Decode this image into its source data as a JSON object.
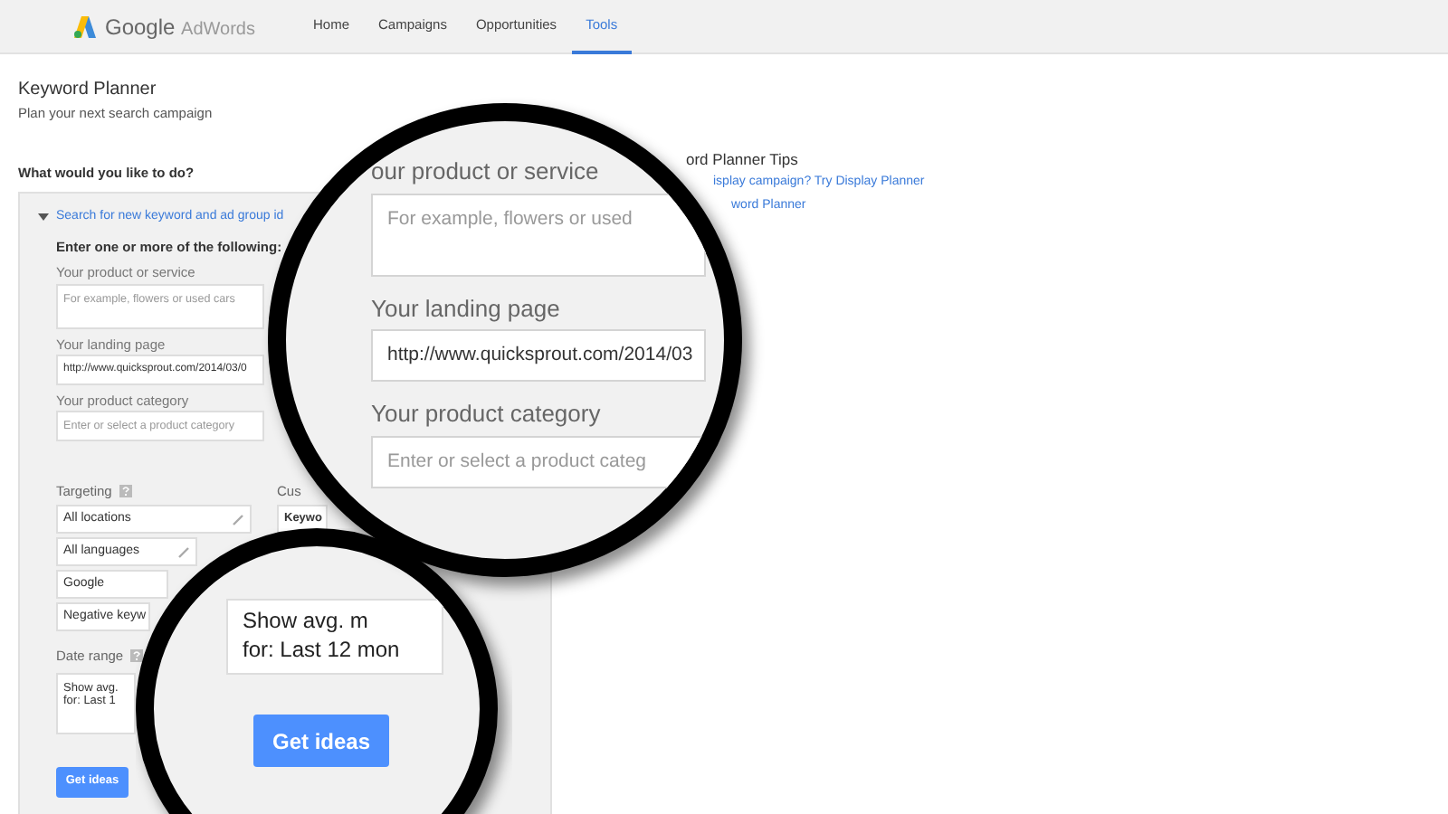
{
  "header": {
    "logo": "Google",
    "product": "AdWords",
    "nav": [
      {
        "label": "Home",
        "selected": false
      },
      {
        "label": "Campaigns",
        "selected": false
      },
      {
        "label": "Opportunities",
        "selected": false
      },
      {
        "label": "Tools",
        "selected": true
      }
    ]
  },
  "page": {
    "title": "Keyword Planner",
    "subtitle": "Plan your next search campaign"
  },
  "question": "What would you like to do?",
  "panel": {
    "option": {
      "label": "Search for new keyword and ad group id",
      "expanded": true
    },
    "instructions": "Enter one or more of the following:",
    "fields": [
      {
        "kind": "textarea",
        "label": "Your product or service",
        "placeholder": "For example, flowers or used cars"
      },
      {
        "kind": "input",
        "label": "Your landing page",
        "value": "http://www.quicksprout.com/2014/03/0"
      },
      {
        "kind": "input",
        "label": "Your product category",
        "placeholder": "Enter or select a product category"
      }
    ],
    "targeting": {
      "label": "Targeting",
      "items": [
        {
          "label": "All locations",
          "pencil": true
        },
        {
          "label": "All languages",
          "pencil": true
        },
        {
          "label": "Google",
          "pencil": false
        },
        {
          "label": "Negative keyw",
          "pencil": false
        }
      ]
    },
    "date_range": {
      "label": "Date range",
      "lines": [
        "Show avg.",
        "for: Last 1"
      ]
    },
    "button": "Get ideas",
    "customize": {
      "label": "Cus",
      "items": [
        "Keywo"
      ]
    }
  },
  "tips": {
    "title": "ord Planner Tips",
    "links": [
      "isplay campaign? Try Display Planner",
      "word Planner"
    ]
  },
  "magnifiers": [
    {
      "kind": "form",
      "fields": [
        {
          "kind": "textarea",
          "label": "our product or service",
          "placeholder": "For example, flowers or used"
        },
        {
          "kind": "input",
          "label": "Your landing page",
          "value": "http://www.quicksprout.com/2014/03"
        },
        {
          "kind": "input",
          "label": "Your product category",
          "placeholder": "Enter or select a product categ"
        }
      ]
    },
    {
      "kind": "button",
      "lines": [
        "Show avg. m",
        "for: Last 12 mon"
      ],
      "button": "Get ideas"
    }
  ]
}
